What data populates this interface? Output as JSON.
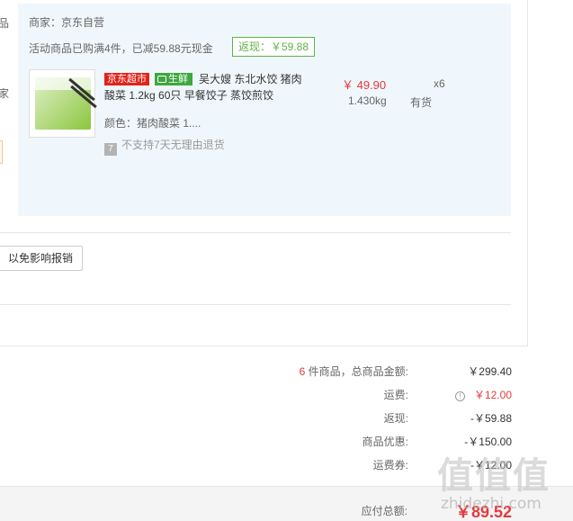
{
  "left_cut": {
    "text1": "品",
    "text2": "家"
  },
  "package": {
    "merchant": "商家：京东自营",
    "promo": "活动商品已购满4件，已减59.88元现金",
    "rebate_tag": "返现：￥59.88",
    "item": {
      "badge_jd": "京东超市",
      "badge_fresh": "生鲜",
      "title": "吴大嫂 东北水饺 猪肉酸菜 1.2kg 60只 早餐饺子 蒸饺煎饺",
      "spec": "颜色：猪肉酸菜 1....",
      "return_note": "不支持7天无理由退货",
      "price": "￥ 49.90",
      "weight": "1.430kg",
      "qty": "x6",
      "stock": "有货"
    }
  },
  "invoice_button": "以免影响报销",
  "summary": {
    "goods": {
      "count": "6",
      "label_suffix": " 件商品，总商品金额:",
      "value": "￥299.40"
    },
    "shipping": {
      "label": "运费:",
      "value": "￥12.00"
    },
    "rebate": {
      "label": "返现:",
      "value": "-￥59.88"
    },
    "discount": {
      "label": "商品优惠:",
      "value": "-￥150.00"
    },
    "coupon": {
      "label": "运费券:",
      "value": "-￥12.00"
    }
  },
  "total": {
    "label": "应付总额:",
    "value": "￥89.52"
  },
  "watermark": {
    "glyphs": "值值值",
    "url": "zhidezhi.com"
  },
  "colors": {
    "accent_red": "#e4393c",
    "fresh_green": "#3ea73e",
    "panel_bg": "#f0f7fc"
  }
}
